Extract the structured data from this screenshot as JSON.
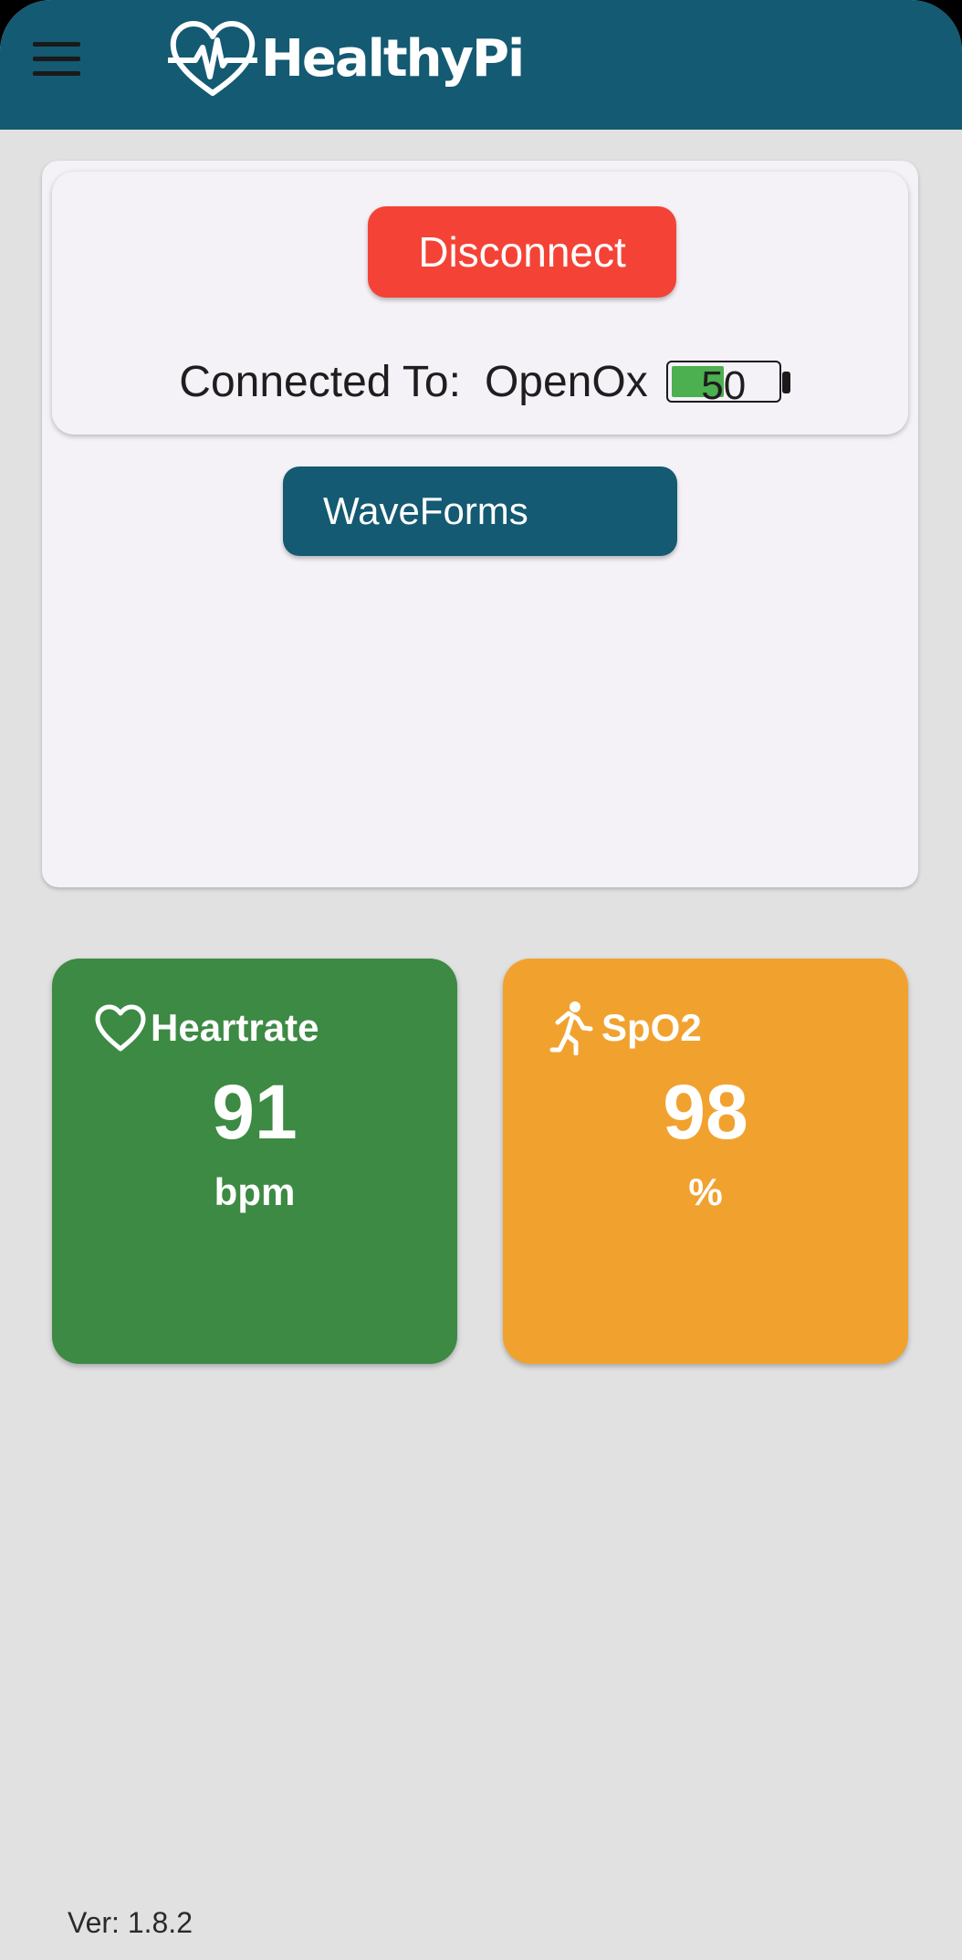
{
  "app": {
    "name": "HealthyPi",
    "header_color": "#135a72",
    "logo_icon": "heart-pulse-icon",
    "menu_icon": "hamburger-menu-icon"
  },
  "connection": {
    "disconnect_label": "Disconnect",
    "connected_label": "Connected To:",
    "device_name": "OpenOx",
    "battery_percent": "50",
    "battery_level": 0.5,
    "battery_color": "#4caf50",
    "disconnect_color": "#f44336"
  },
  "waveforms": {
    "label": "WaveForms"
  },
  "vitals": [
    {
      "title": "Heartrate",
      "icon": "heart-outline-icon",
      "value": "91",
      "unit": "bpm",
      "color": "#3c8a43"
    },
    {
      "title": "SpO2",
      "icon": "running-person-icon",
      "value": "98",
      "unit": "%",
      "color": "#f1a22e"
    }
  ],
  "footer": {
    "version": "Ver: 1.8.2"
  }
}
